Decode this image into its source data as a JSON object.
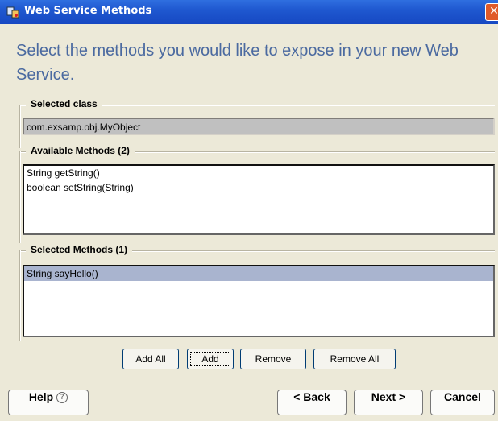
{
  "window": {
    "title": "Web Service Methods",
    "close_glyph": "✕"
  },
  "heading": "Select the methods you would like to expose in your new Web Service.",
  "selected_class": {
    "label": "Selected class",
    "value": "com.exsamp.obj.MyObject"
  },
  "available_methods": {
    "label": "Available Methods (2)",
    "items": [
      "String getString()",
      "boolean setString(String)"
    ]
  },
  "selected_methods": {
    "label": "Selected Methods (1)",
    "items": [
      "String sayHello()"
    ]
  },
  "buttons": {
    "add_all": "Add All",
    "add": "Add",
    "remove": "Remove",
    "remove_all": "Remove All",
    "help": "Help",
    "help_glyph": "?",
    "back": "< Back",
    "next": "Next >",
    "cancel": "Cancel"
  }
}
